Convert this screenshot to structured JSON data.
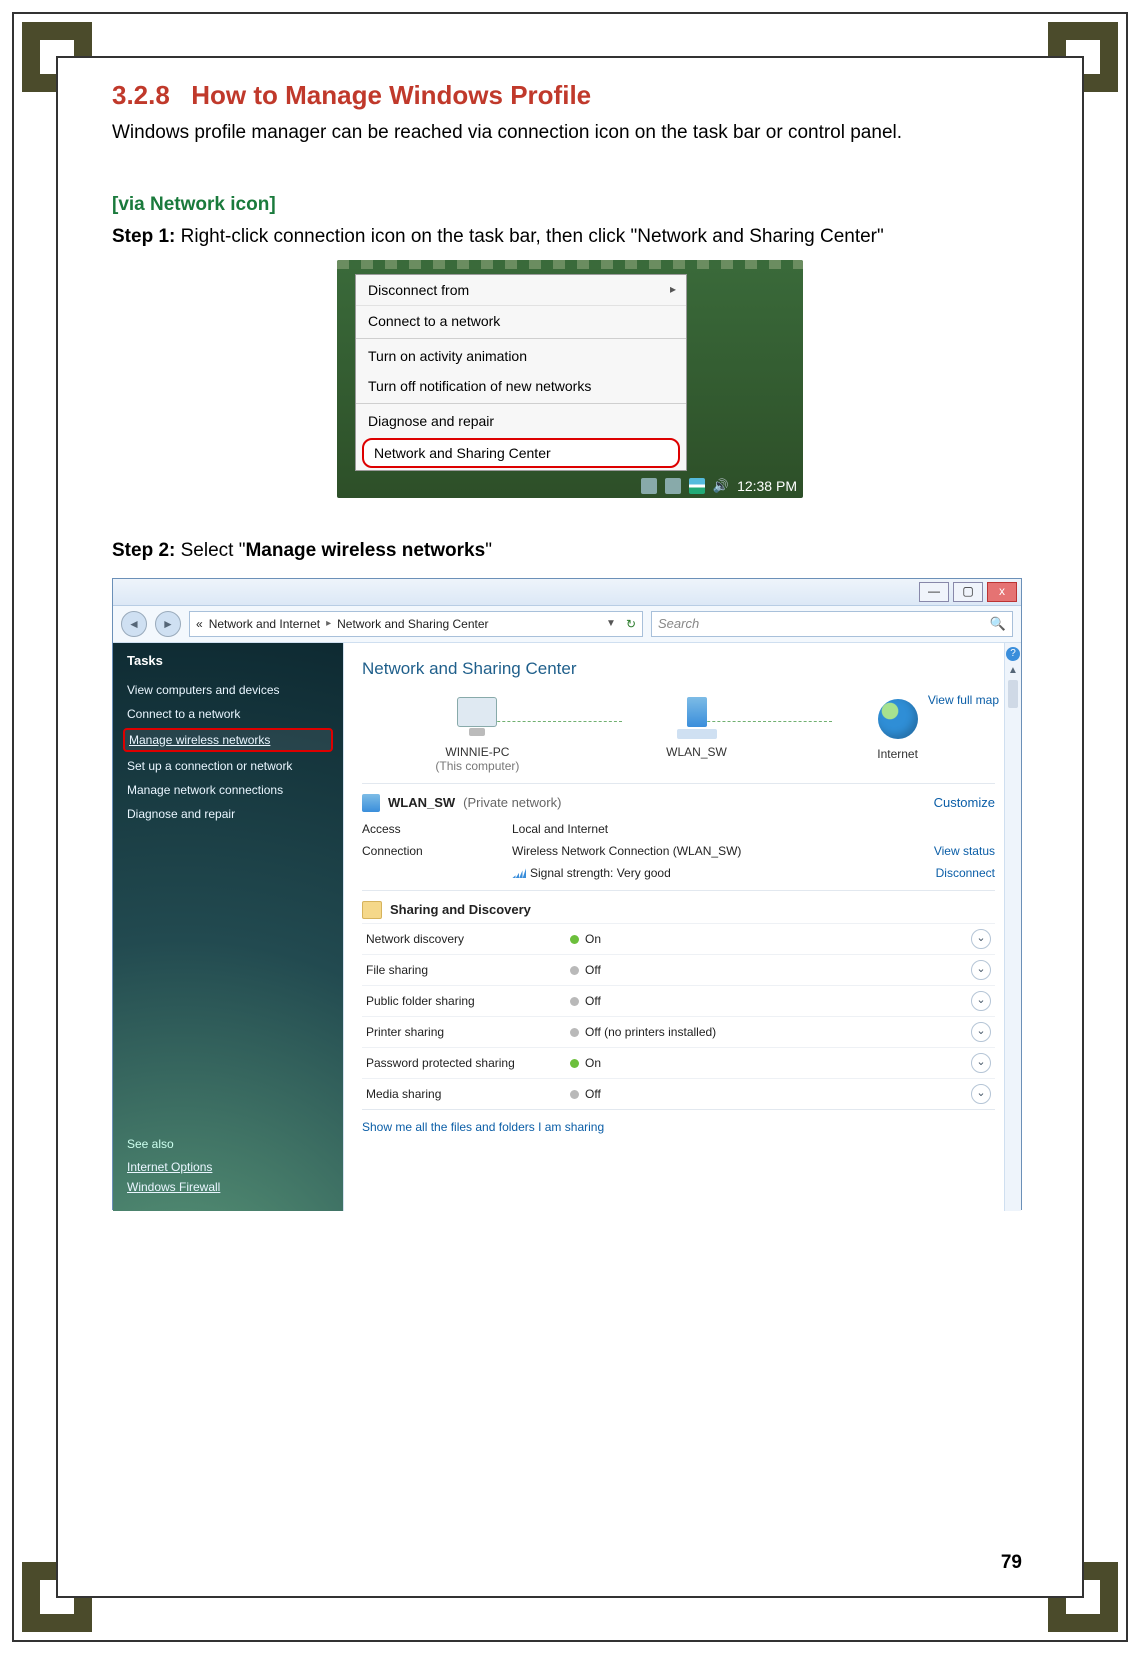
{
  "section": {
    "num": "3.2.8",
    "title": "How to Manage Windows Profile"
  },
  "intro": "Windows profile manager can be reached via connection icon on the task bar or control panel.",
  "subhead": "[via Network icon]",
  "step1": {
    "label": "Step 1:",
    "text": " Right-click connection icon on the task bar, then click \"Network and Sharing Center\""
  },
  "step2": {
    "label": "Step 2:",
    "prefix": " Select \"",
    "bold": "Manage wireless networks",
    "suffix": "\""
  },
  "ctx_menu": {
    "items": [
      "Disconnect from",
      "Connect to a network",
      "Turn on activity animation",
      "Turn off notification of new networks",
      "Diagnose and repair",
      "Network and Sharing Center"
    ],
    "clock": "12:38 PM"
  },
  "vista": {
    "win_buttons": {
      "min": "—",
      "max": "▢",
      "close": "x"
    },
    "breadcrumb": {
      "lead": "«",
      "part1": "Network and Internet",
      "sep": "▸",
      "part2": "Network and Sharing Center"
    },
    "search_placeholder": "Search",
    "tasks_header": "Tasks",
    "tasks": [
      "View computers and devices",
      "Connect to a network",
      "Manage wireless networks",
      "Set up a connection or network",
      "Manage network connections",
      "Diagnose and repair"
    ],
    "see_also_header": "See also",
    "see_also": [
      "Internet Options",
      "Windows Firewall"
    ],
    "main_title": "Network and Sharing Center",
    "view_full_map": "View full map",
    "nodes": {
      "pc": "WINNIE-PC",
      "pc_sub": "(This computer)",
      "net": "WLAN_SW",
      "inet": "Internet"
    },
    "net_block": {
      "name": "WLAN_SW",
      "kind": "(Private network)",
      "customize": "Customize",
      "rows": {
        "access_l": "Access",
        "access_v": "Local and Internet",
        "conn_l": "Connection",
        "conn_v": "Wireless Network Connection (WLAN_SW)",
        "view_status": "View status",
        "signal_l": "Signal strength:  Very good",
        "disconnect": "Disconnect"
      }
    },
    "sd_header": "Sharing and Discovery",
    "sd_rows": [
      {
        "label": "Network discovery",
        "state": "On",
        "on": true
      },
      {
        "label": "File sharing",
        "state": "Off",
        "on": false
      },
      {
        "label": "Public folder sharing",
        "state": "Off",
        "on": false
      },
      {
        "label": "Printer sharing",
        "state": "Off (no printers installed)",
        "on": false
      },
      {
        "label": "Password protected sharing",
        "state": "On",
        "on": true
      },
      {
        "label": "Media sharing",
        "state": "Off",
        "on": false
      }
    ],
    "footer_link": "Show me all the files and folders I am sharing"
  },
  "page_number": "79"
}
